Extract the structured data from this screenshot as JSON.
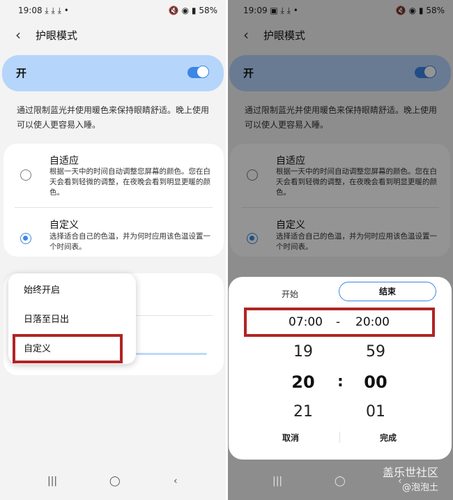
{
  "left": {
    "status": {
      "time": "19:08 ⤓ ⤓ ⤓ •",
      "right": "🔇 ◉ ▮ 58%"
    },
    "header": {
      "back": "‹",
      "title": "护眼模式"
    },
    "toggle": {
      "label": "开"
    },
    "description": "通过限制蓝光并使用暖色来保持眼睛舒适。晚上使用可以使人更容易入睡。",
    "options": [
      {
        "title": "自适应",
        "subtitle": "根据一天中的时间自动调整您屏幕的颜色。您在白天会看到轻微的调整，在夜晚会看到明显更暖的颜色。"
      },
      {
        "title": "自定义",
        "subtitle": "选择适合自己的色温，并为何时应用该色温设置一个时间表。"
      }
    ],
    "menu": [
      "始终开启",
      "日落至日出",
      "自定义"
    ],
    "nav": {
      "recent": "|||",
      "home": "◯",
      "back": "‹"
    }
  },
  "right": {
    "status": {
      "time": "19:09 ▣ ⤓ ⤓ •",
      "right": "🔇 ◉ ▮ 58%"
    },
    "sheet": {
      "tab_start": "开始",
      "tab_end": "结束",
      "range_start": "07:00",
      "range_dash": "-",
      "range_end": "20:00",
      "hours": [
        "19",
        "20",
        "21"
      ],
      "minutes": [
        "59",
        "00",
        "01"
      ],
      "colon": ":",
      "cancel": "取消",
      "done": "完成"
    },
    "watermark": "盖乐世社区",
    "watermark2": "@泡泡土"
  },
  "colors": {
    "accent": "#3b86e6",
    "highlight": "#b02424",
    "toggle_card": "#b6d5fb"
  }
}
